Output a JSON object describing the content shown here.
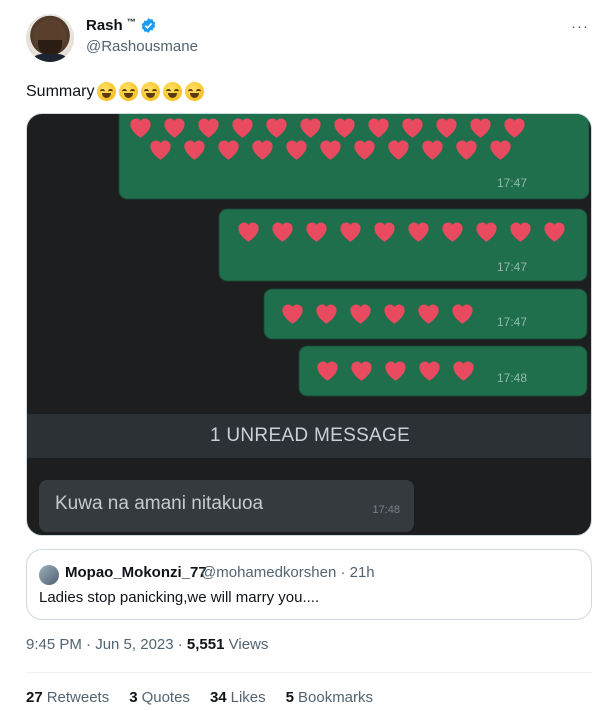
{
  "author": {
    "name": "Rash",
    "tm": "™",
    "handle": "@Rashousmane",
    "more_icon": "more-dots-icon"
  },
  "tweet": {
    "text": "Summary"
  },
  "media": {
    "timestamps": [
      "17:47",
      "17:47",
      "17:47",
      "17:48"
    ],
    "unread_label": "1 UNREAD MESSAGE",
    "incoming_text": "Kuwa na amani nitakuoa",
    "incoming_time": "17:48"
  },
  "quote": {
    "name": "Mopao_Mokonzi_77",
    "handle": "@mohamedkorshen · 21h",
    "text": "Ladies stop panicking,we will marry you...."
  },
  "meta": {
    "time": "9:45 PM · Jun 5, 2023 · ",
    "views_count": "5,551",
    "views_label": " Views"
  },
  "stats": [
    {
      "count": "27",
      "label": "Retweets"
    },
    {
      "count": "3",
      "label": "Quotes"
    },
    {
      "count": "34",
      "label": "Likes"
    },
    {
      "count": "5",
      "label": "Bookmarks"
    }
  ],
  "colors": {
    "bubble": "#1f6e4c",
    "heart": "#e84a5f",
    "verified": "#1d9bf0"
  }
}
